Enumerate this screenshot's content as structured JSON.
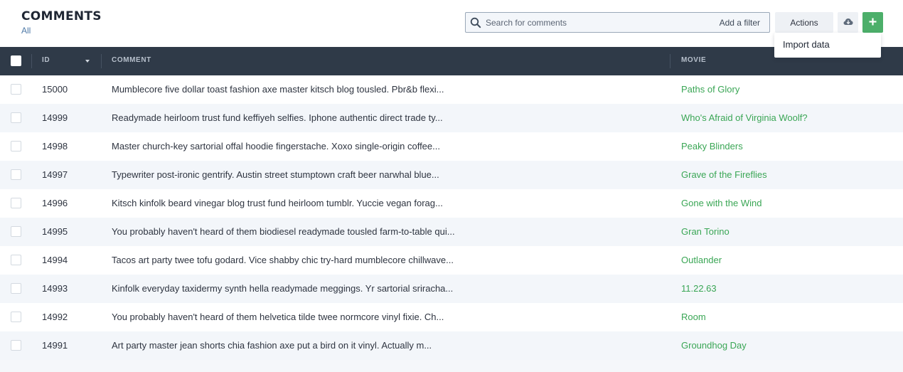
{
  "header": {
    "title": "COMMENTS",
    "subtitle": "All"
  },
  "search": {
    "placeholder": "Search for comments",
    "value": "",
    "add_filter_label": "Add a filter"
  },
  "toolbar": {
    "actions_label": "Actions",
    "cloud_icon": "cloud-download-icon",
    "add_icon": "plus-icon",
    "accent_color": "#4caf6a"
  },
  "actions_menu": {
    "items": [
      {
        "label": "Import data"
      }
    ]
  },
  "table": {
    "columns": [
      {
        "label": "ID",
        "sortable": true
      },
      {
        "label": "COMMENT"
      },
      {
        "label": "MOVIE"
      }
    ],
    "rows": [
      {
        "id": "15000",
        "comment": "Mumblecore five dollar toast fashion axe master kitsch blog tousled. Pbr&b flexi...",
        "movie": "Paths of Glory"
      },
      {
        "id": "14999",
        "comment": "Readymade heirloom trust fund keffiyeh selfies. Iphone authentic direct trade ty...",
        "movie": "Who's Afraid of Virginia Woolf?"
      },
      {
        "id": "14998",
        "comment": "Master church-key sartorial offal hoodie fingerstache. Xoxo single-origin coffee...",
        "movie": "Peaky Blinders"
      },
      {
        "id": "14997",
        "comment": "Typewriter post-ironic gentrify. Austin street stumptown craft beer narwhal blue...",
        "movie": "Grave of the Fireflies"
      },
      {
        "id": "14996",
        "comment": "Kitsch kinfolk beard vinegar blog trust fund heirloom tumblr. Yuccie vegan forag...",
        "movie": "Gone with the Wind"
      },
      {
        "id": "14995",
        "comment": "You probably haven't heard of them biodiesel readymade tousled farm-to-table qui...",
        "movie": "Gran Torino"
      },
      {
        "id": "14994",
        "comment": "Tacos art party twee tofu godard. Vice shabby chic try-hard mumblecore chillwave...",
        "movie": "Outlander"
      },
      {
        "id": "14993",
        "comment": "Kinfolk everyday taxidermy synth hella readymade meggings. Yr sartorial sriracha...",
        "movie": "11.22.63"
      },
      {
        "id": "14992",
        "comment": "You probably haven't heard of them helvetica tilde twee normcore vinyl fixie. Ch...",
        "movie": "Room"
      },
      {
        "id": "14991",
        "comment": "Art party master jean shorts chia fashion axe put a bird on it vinyl. Actually m...",
        "movie": "Groundhog Day"
      }
    ]
  }
}
